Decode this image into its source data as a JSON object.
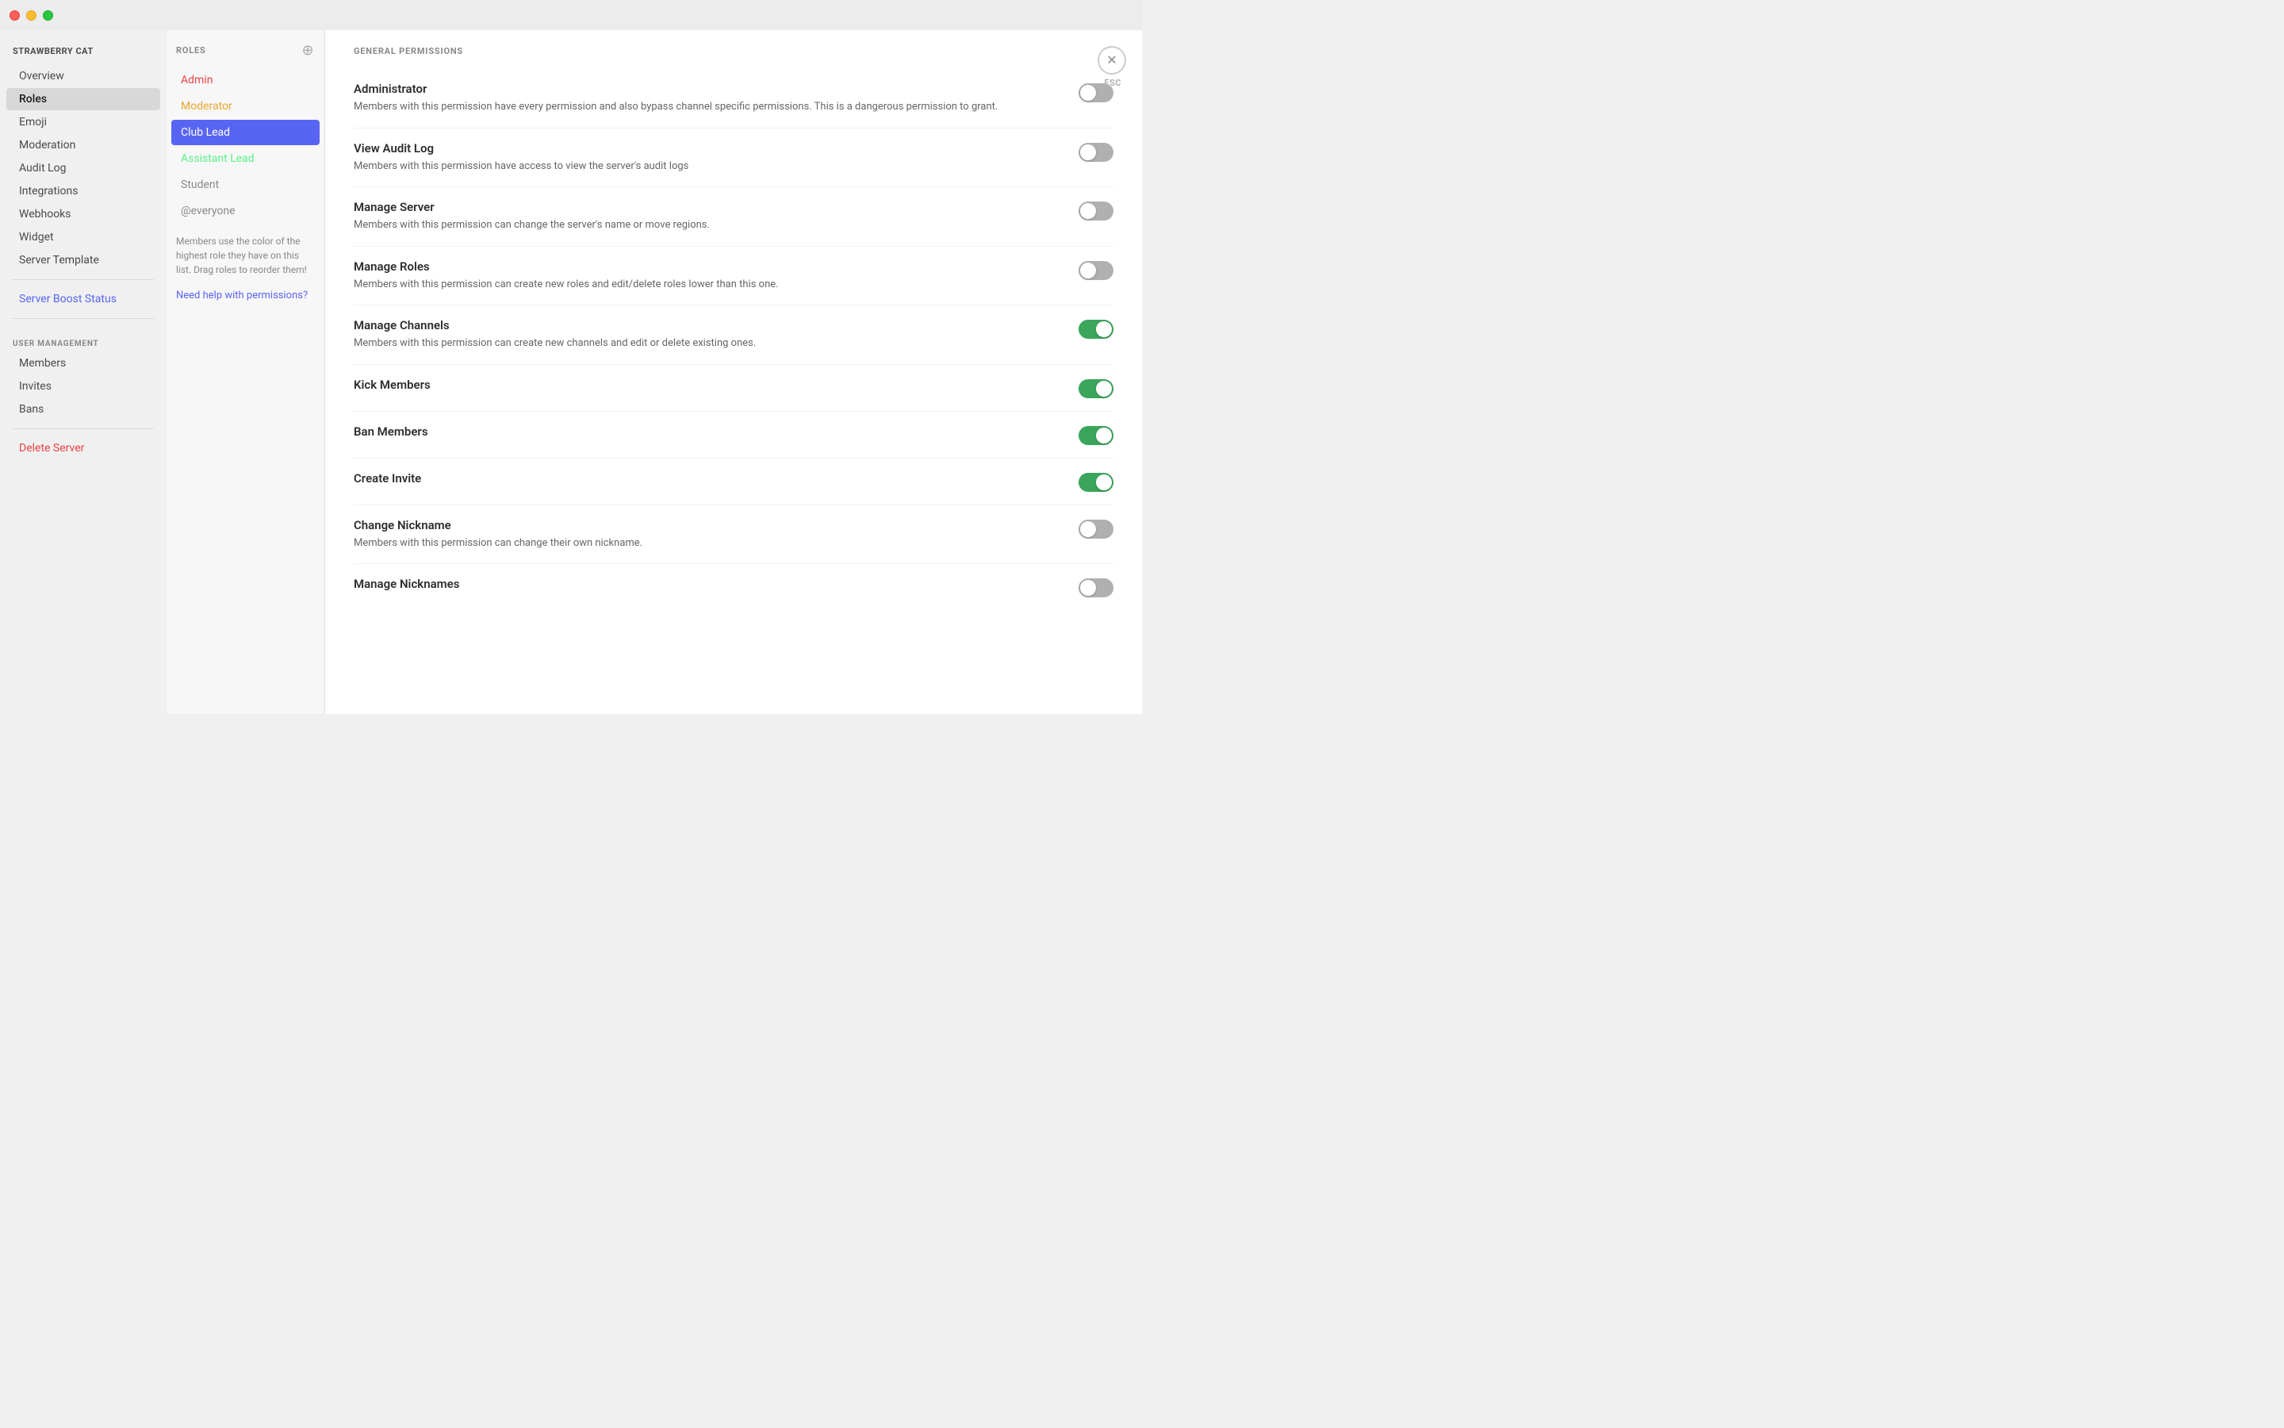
{
  "titleBar": {
    "trafficLights": [
      "close",
      "minimize",
      "maximize"
    ]
  },
  "leftSidebar": {
    "serverName": "STRAWBERRY CAT",
    "mainItems": [
      {
        "id": "overview",
        "label": "Overview",
        "active": false
      },
      {
        "id": "roles",
        "label": "Roles",
        "active": true
      },
      {
        "id": "emoji",
        "label": "Emoji",
        "active": false
      },
      {
        "id": "moderation",
        "label": "Moderation",
        "active": false
      },
      {
        "id": "audit-log",
        "label": "Audit Log",
        "active": false
      },
      {
        "id": "integrations",
        "label": "Integrations",
        "active": false
      },
      {
        "id": "webhooks",
        "label": "Webhooks",
        "active": false
      },
      {
        "id": "widget",
        "label": "Widget",
        "active": false
      },
      {
        "id": "server-template",
        "label": "Server Template",
        "active": false
      }
    ],
    "boostItem": {
      "id": "server-boost-status",
      "label": "Server Boost Status"
    },
    "userManagementLabel": "USER MANAGEMENT",
    "userManagementItems": [
      {
        "id": "members",
        "label": "Members"
      },
      {
        "id": "invites",
        "label": "Invites"
      },
      {
        "id": "bans",
        "label": "Bans"
      }
    ],
    "deleteServer": "Delete Server"
  },
  "rolesPanel": {
    "header": "ROLES",
    "roles": [
      {
        "id": "admin",
        "label": "Admin",
        "colorClass": "role-admin"
      },
      {
        "id": "moderator",
        "label": "Moderator",
        "colorClass": "role-moderator"
      },
      {
        "id": "club-lead",
        "label": "Club Lead",
        "active": true
      },
      {
        "id": "assistant-lead",
        "label": "Assistant Lead",
        "colorClass": "role-assistant"
      },
      {
        "id": "student",
        "label": "Student",
        "colorClass": "role-student"
      },
      {
        "id": "everyone",
        "label": "@everyone",
        "colorClass": "role-everyone"
      }
    ],
    "hint": "Members use the color of the highest role they have on this list. Drag roles to reorder them!",
    "needHelp": "Need help with permissions?"
  },
  "permissionsPanel": {
    "sectionLabel": "GENERAL PERMISSIONS",
    "closeLabel": "×",
    "escLabel": "ESC",
    "permissions": [
      {
        "id": "administrator",
        "name": "Administrator",
        "desc": "Members with this permission have every permission and also bypass channel specific permissions. This is a dangerous permission to grant.",
        "state": "off"
      },
      {
        "id": "view-audit-log",
        "name": "View Audit Log",
        "desc": "Members with this permission have access to view the server's audit logs",
        "state": "off"
      },
      {
        "id": "manage-server",
        "name": "Manage Server",
        "desc": "Members with this permission can change the server's name or move regions.",
        "state": "off"
      },
      {
        "id": "manage-roles",
        "name": "Manage Roles",
        "desc": "Members with this permission can create new roles and edit/delete roles lower than this one.",
        "state": "off"
      },
      {
        "id": "manage-channels",
        "name": "Manage Channels",
        "desc": "Members with this permission can create new channels and edit or delete existing ones.",
        "state": "on"
      },
      {
        "id": "kick-members",
        "name": "Kick Members",
        "desc": "",
        "state": "on"
      },
      {
        "id": "ban-members",
        "name": "Ban Members",
        "desc": "",
        "state": "on"
      },
      {
        "id": "create-invite",
        "name": "Create Invite",
        "desc": "",
        "state": "on"
      },
      {
        "id": "change-nickname",
        "name": "Change Nickname",
        "desc": "Members with this permission can change their own nickname.",
        "state": "off"
      },
      {
        "id": "manage-nicknames",
        "name": "Manage Nicknames",
        "desc": "",
        "state": "off"
      }
    ]
  }
}
